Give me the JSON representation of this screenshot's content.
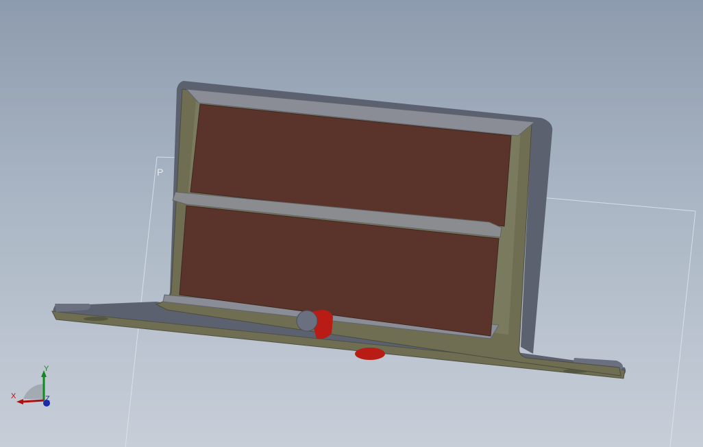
{
  "viewport": {
    "plane_label": "P",
    "triad": {
      "x_label": "X",
      "y_label": "Y",
      "z_label": "Z"
    }
  },
  "colors": {
    "background_top": "#8d9bae",
    "background_bottom": "#c7ced8",
    "bracket_face": "#6f6e53",
    "bracket_edge": "#5c6170",
    "cushion": "#5a342b",
    "divider": "#8a8c90",
    "fastener": "#b81c14",
    "axis_x": "#b01010",
    "axis_y": "#0f8a1f",
    "axis_z": "#1a2aa8"
  },
  "icons": [
    "coordinate-triad-icon"
  ]
}
